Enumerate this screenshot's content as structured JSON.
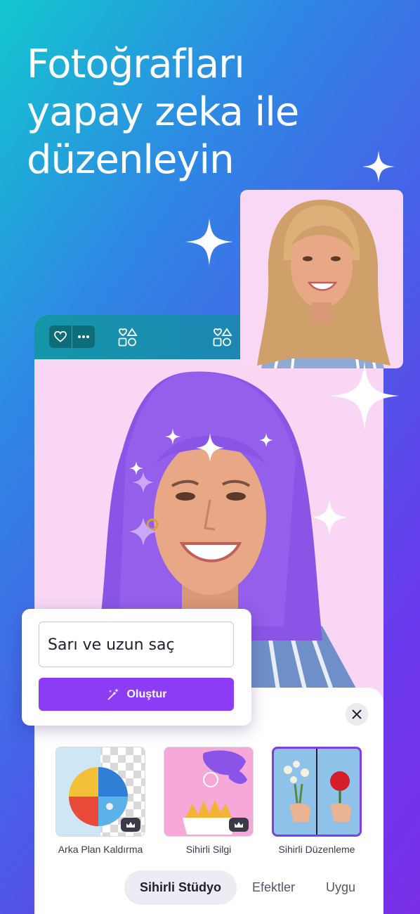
{
  "headline": {
    "line1": "Fotoğrafları",
    "line2": "yapay zeka ile",
    "line3": "düzenleyin"
  },
  "prompt": {
    "value": "Sarı ve uzun saç",
    "button_label": "Oluştur"
  },
  "tools": [
    {
      "label": "Arka Plan Kaldırma",
      "premium": true
    },
    {
      "label": "Sihirli Silgi",
      "premium": true
    },
    {
      "label": "Sihirli Düzenleme",
      "premium": false,
      "selected": true
    }
  ],
  "tabs": [
    {
      "label": "Sihirli Stüdyo",
      "active": true
    },
    {
      "label": "Efektler",
      "active": false
    },
    {
      "label": "Uygu",
      "active": false
    }
  ],
  "colors": {
    "accent": "#8b3cf4",
    "hair": "#8a55e6",
    "canvas_bg": "#f8d6f4"
  },
  "icons": [
    "heart-icon",
    "more-icon",
    "elements-icon",
    "close-icon",
    "crown-icon",
    "magic-wand-icon",
    "sparkle-icon"
  ]
}
